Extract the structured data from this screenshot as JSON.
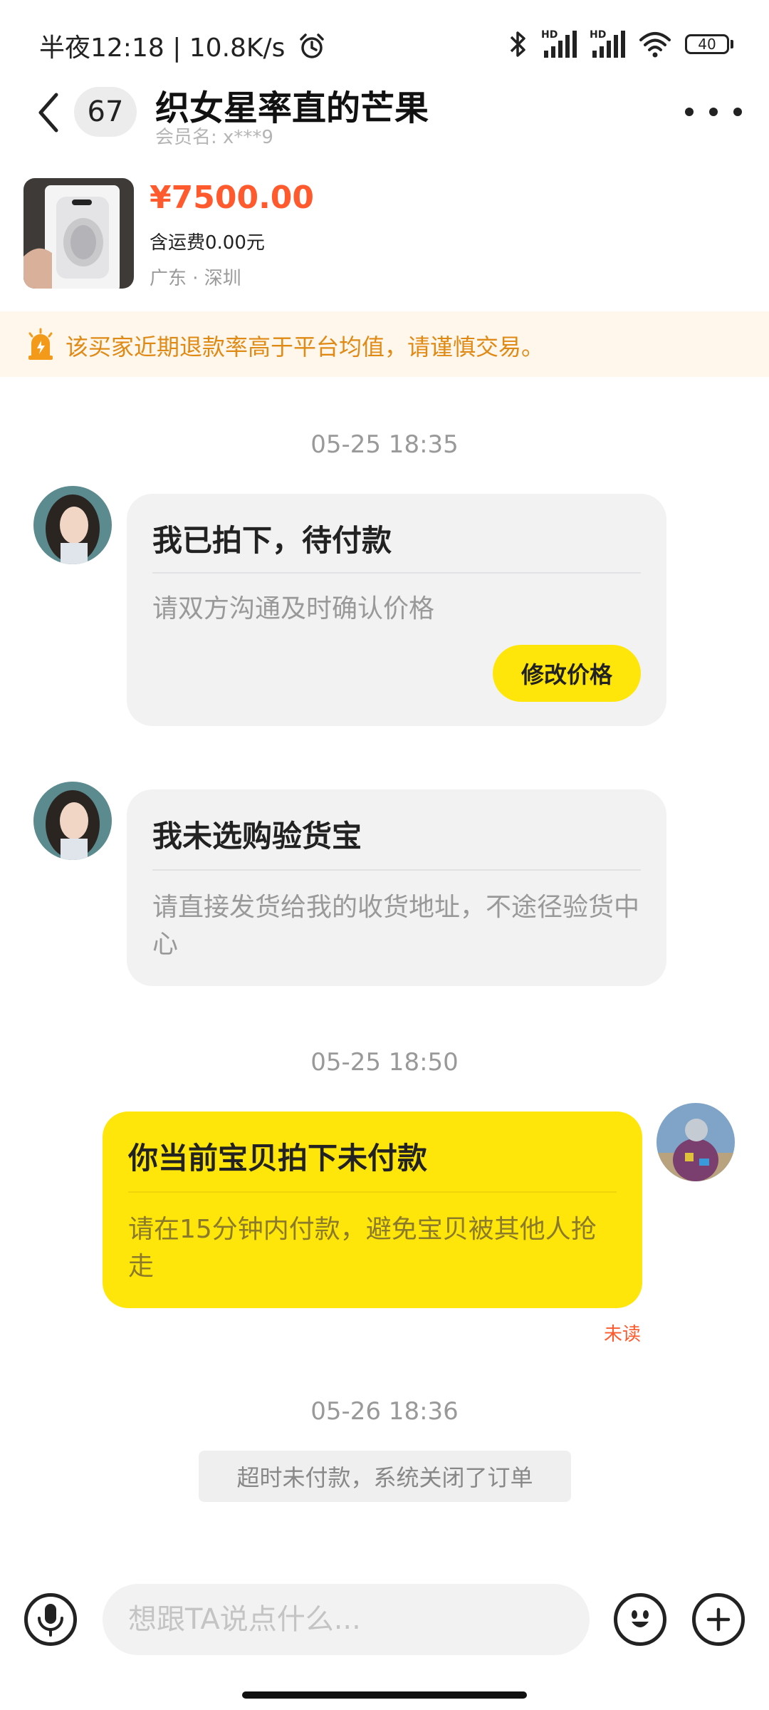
{
  "status_bar": {
    "time_text": "半夜12:18 | 10.8K/s",
    "battery": "40",
    "hd_label": "HD",
    "icons": [
      "alarm-icon",
      "bluetooth-icon",
      "signal-icon",
      "signal-icon",
      "wifi-icon",
      "battery-icon"
    ]
  },
  "header": {
    "back_icon": "chevron-left-icon",
    "unread_count": "67",
    "title": "织女星率直的芒果",
    "member_label": "会员名: x***9",
    "more_icon": "more-dots-icon"
  },
  "product": {
    "price": "¥7500.00",
    "shipping": "含运费0.00元",
    "location": "广东 · 深圳"
  },
  "warning": {
    "text": "该买家近期退款率高于平台均值，请谨慎交易。",
    "color": "#e08a16",
    "background": "#fff6ec"
  },
  "messages": [
    {
      "timestamp": "05-25 18:35",
      "sender": "buyer",
      "title": "我已拍下，待付款",
      "body": "请双方沟通及时确认价格",
      "button_label": "修改价格"
    },
    {
      "sender": "buyer",
      "title": "我未选购验货宝",
      "body": "请直接发货给我的收货地址，不途径验货中心"
    },
    {
      "timestamp": "05-25 18:50",
      "sender": "seller",
      "title": "你当前宝贝拍下未付款",
      "body": "请在15分钟内付款，避免宝贝被其他人抢走",
      "status": "未读"
    },
    {
      "timestamp": "05-26 18:36",
      "system_notice": "超时未付款，系统关闭了订单"
    }
  ],
  "composer": {
    "placeholder": "想跟TA说点什么...",
    "voice_icon": "microphone-icon",
    "emoji_icon": "emoji-icon",
    "add_icon": "plus-icon"
  },
  "colors": {
    "accent_yellow": "#ffe60a",
    "price_orange": "#ff5a2e",
    "bubble_gray": "#f2f2f3"
  }
}
